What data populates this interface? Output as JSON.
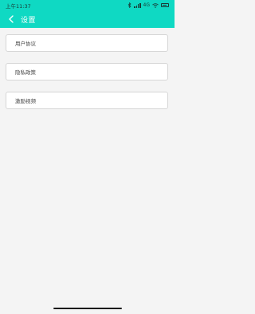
{
  "status_bar": {
    "time": "上午11:37",
    "network_label": "4G"
  },
  "header": {
    "title": "设置",
    "background": "#0fd9c3"
  },
  "settings_items": [
    {
      "label": "用户协议"
    },
    {
      "label": "隐私政策"
    },
    {
      "label": "激励视频"
    }
  ],
  "icons": {
    "back": "chevron-left-icon",
    "bluetooth": "bluetooth-icon",
    "signal": "signal-icon",
    "wifi": "wifi-icon",
    "battery": "battery-icon"
  }
}
